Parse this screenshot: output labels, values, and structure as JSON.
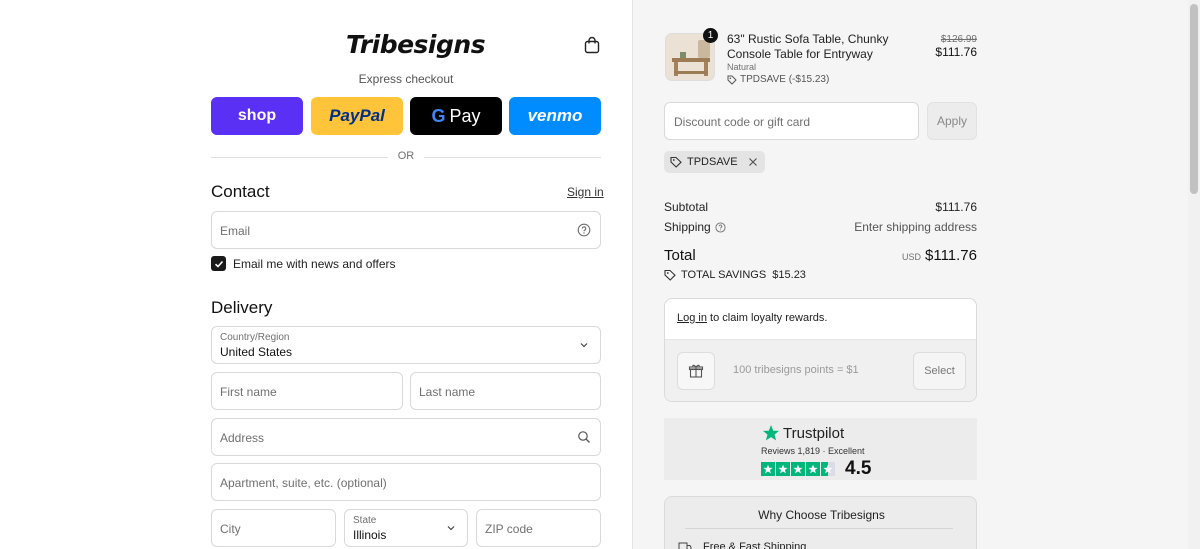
{
  "header": {
    "logo": "Tribesigns",
    "express_label": "Express checkout"
  },
  "express_pay": {
    "shop": "shop",
    "paypal": "PayPal",
    "gpay": "Pay",
    "venmo": "venmo",
    "or": "OR"
  },
  "contact": {
    "title": "Contact",
    "signin": "Sign in",
    "email_placeholder": "Email",
    "newsletter_label": "Email me with news and offers",
    "newsletter_checked": true
  },
  "delivery": {
    "title": "Delivery",
    "country_label": "Country/Region",
    "country_value": "United States",
    "first_name": "First name",
    "last_name": "Last name",
    "address": "Address",
    "apartment": "Apartment, suite, etc. (optional)",
    "city": "City",
    "state_label": "State",
    "state_value": "Illinois",
    "zip": "ZIP code"
  },
  "cart": {
    "quantity": "1",
    "product_name": "63\" Rustic Sofa Table, Chunky Console Table for Entryway",
    "variant": "Natural",
    "discount_applied": "TPDSAVE (-$15.23)",
    "old_price": "$126.99",
    "price": "$111.76"
  },
  "discount": {
    "placeholder": "Discount code or gift card",
    "apply": "Apply",
    "code": "TPDSAVE"
  },
  "summary": {
    "subtotal_label": "Subtotal",
    "subtotal_value": "$111.76",
    "shipping_label": "Shipping",
    "shipping_value": "Enter shipping address",
    "total_label": "Total",
    "currency": "USD",
    "total_value": "$111.76",
    "savings": "TOTAL SAVINGS  $15.23"
  },
  "loyalty": {
    "login": "Log in",
    "text": " to claim loyalty rewards.",
    "points_placeholder": "100 tribesigns points = $1",
    "select": "Select"
  },
  "trustpilot": {
    "brand": "Trustpilot",
    "reviews": "Reviews 1,819 · Excellent",
    "score": "4.5"
  },
  "why": {
    "title": "Why Choose Tribesigns",
    "item": "Free & Fast Shipping"
  },
  "colors": {
    "shop": "#5a31f4",
    "paypal": "#ffc439",
    "gpay": "#000000",
    "venmo": "#008cff",
    "trustpilot": "#00b67a"
  }
}
